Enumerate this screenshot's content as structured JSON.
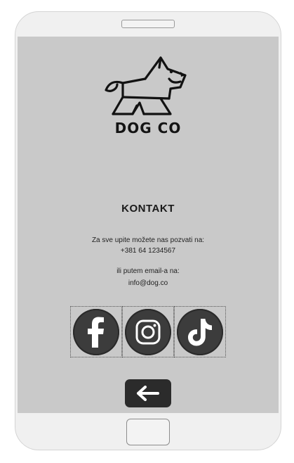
{
  "brand": {
    "name": "DOG CO",
    "logo_icon": "dog-logo-icon"
  },
  "contact": {
    "heading": "KONTAKT",
    "phone_intro": "Za sve upite možete nas pozvati na:",
    "phone_number": "+381 64 1234567",
    "email_intro": "ili putem email-a na:",
    "email": "info@dog.co"
  },
  "socials": [
    {
      "name": "Facebook",
      "icon": "facebook-icon"
    },
    {
      "name": "Instagram",
      "icon": "instagram-icon"
    },
    {
      "name": "TikTok",
      "icon": "tiktok-icon"
    }
  ],
  "navigation": {
    "back_icon": "arrow-left-icon"
  },
  "colors": {
    "screen_background": "#c9c9c9",
    "phone_frame": "#f0f0f0",
    "icon_circle": "#3c3c3c",
    "back_button": "#2b2b2b"
  }
}
